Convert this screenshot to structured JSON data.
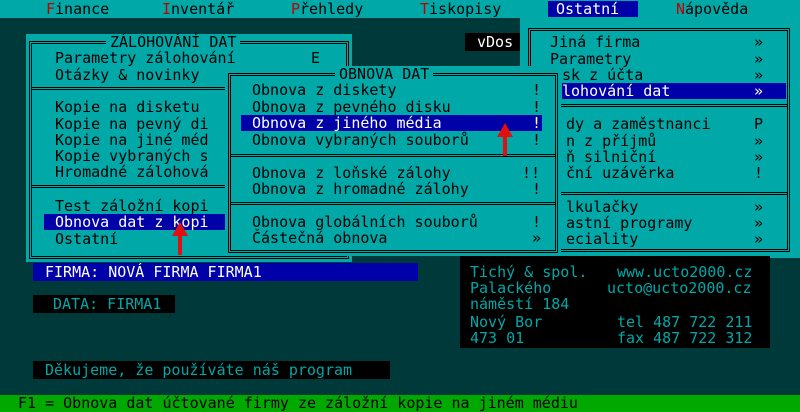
{
  "menubar": [
    {
      "label": "Finance",
      "hot": "F"
    },
    {
      "label": "Inventář",
      "hot": "I"
    },
    {
      "label": "Přehledy",
      "hot": "P"
    },
    {
      "label": "Tiskopisy",
      "hot": "T"
    },
    {
      "label": "Ostatní",
      "hot": "O",
      "selected": true
    },
    {
      "label": "Nápověda",
      "hot": "N"
    }
  ],
  "vdos_label": "vDos",
  "ostatni_menu": {
    "items": [
      {
        "label": "Jiná firma",
        "key": "»"
      },
      {
        "label": "Parametry",
        "key": "»"
      },
      {
        "label": "sk z účta",
        "key": "»"
      },
      {
        "label": "lohování dat",
        "key": "»",
        "selected": true
      },
      {
        "label": "dy a zaměstnanci",
        "key": "P"
      },
      {
        "label": "n z příjmů",
        "key": "»"
      },
      {
        "label": "ň silniční",
        "key": "»"
      },
      {
        "label": "ční uzávěrka",
        "key": "!"
      },
      {
        "label": "lkulačky",
        "key": "»"
      },
      {
        "label": "astní programy",
        "key": "»"
      },
      {
        "label": "eciality",
        "key": "»"
      }
    ]
  },
  "zalohovani_menu": {
    "title": "ZÁLOHOVÁNÍ DAT",
    "items": [
      {
        "label": "Parametry zálohování",
        "key": "E"
      },
      {
        "label": "Otázky & novinky",
        "key": ""
      },
      {
        "label": "Kopie na disketu",
        "key": ""
      },
      {
        "label": "Kopie na pevný di",
        "key": ""
      },
      {
        "label": "Kopie na jiné méd",
        "key": ""
      },
      {
        "label": "Kopie vybraných s",
        "key": ""
      },
      {
        "label": "Hromadné zálohová",
        "key": ""
      },
      {
        "label": "Test záložní kopi",
        "key": ""
      },
      {
        "label": "Obnova dat z kopi",
        "key": "",
        "selected": true
      },
      {
        "label": "Ostatní",
        "key": ""
      }
    ]
  },
  "obnova_menu": {
    "title": "OBNOVA DAT",
    "items": [
      {
        "label": "Obnova z diskety",
        "key": "!"
      },
      {
        "label": "Obnova z pevného disku",
        "key": "!"
      },
      {
        "label": "Obnova z jiného média",
        "key": "!",
        "selected": true
      },
      {
        "label": "Obnova vybraných souborů",
        "key": "!"
      },
      {
        "label": "Obnova z loňské zálohy",
        "key": "!!"
      },
      {
        "label": "Obnova z hromadné zálohy",
        "key": "!"
      },
      {
        "label": "Obnova globálních souborů",
        "key": "!"
      },
      {
        "label": "Částečná obnova",
        "key": "»"
      }
    ]
  },
  "firma_label": "FIRMA: NOVÁ FIRMA FIRMA1",
  "data_label": "DATA: FIRMA1",
  "company_info": {
    "left": [
      "Tichý & spol.",
      "Palackého",
      "náměstí 184",
      "Nový Bor",
      "473 01"
    ],
    "right": [
      "www.ucto2000.cz",
      "ucto@ucto2000.cz",
      "",
      "tel 487 722 211",
      "fax 487 722 312"
    ]
  },
  "thanks": "Děkujeme, že používáte náš program",
  "status_line": "F1 = Obnova dat účtované firmy ze záložní kopie na jiném médiu",
  "colors": {
    "background": "#00393a",
    "panel": "#00a8a8",
    "selection": "#0000a8",
    "hotkey": "#c00000",
    "status": "#00a800",
    "arrow": "#e01010"
  }
}
